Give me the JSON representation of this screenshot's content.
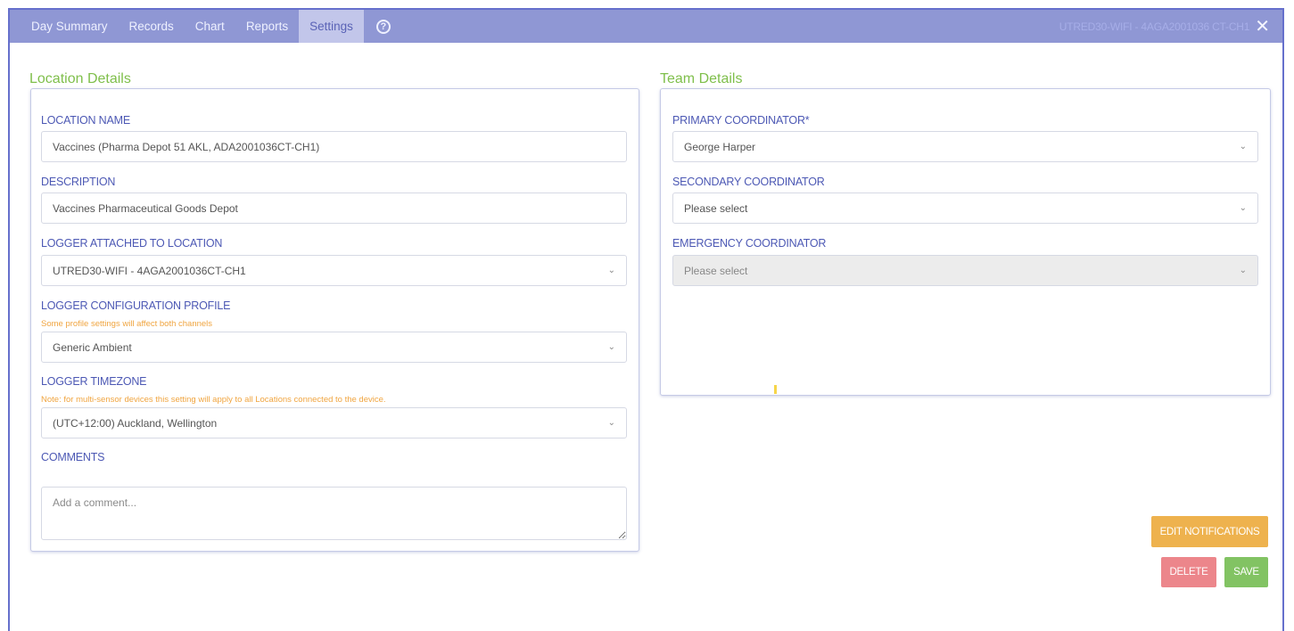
{
  "nav": {
    "tabs": [
      {
        "label": "Day Summary"
      },
      {
        "label": "Records"
      },
      {
        "label": "Chart"
      },
      {
        "label": "Reports"
      },
      {
        "label": "Settings"
      }
    ],
    "help_icon": "?",
    "device_id": "UTRED30-WIFI - 4AGA2001036 CT-CH1",
    "close_icon": "✕"
  },
  "location": {
    "title": "Location Details",
    "name_label": "LOCATION NAME",
    "name_value": "Vaccines (Pharma Depot 51 AKL, ADA2001036CT-CH1)",
    "description_label": "DESCRIPTION",
    "description_value": "Vaccines Pharmaceutical Goods Depot",
    "logger_label": "LOGGER ATTACHED TO LOCATION",
    "logger_value": "UTRED30-WIFI - 4AGA2001036CT-CH1",
    "profile_label": "LOGGER CONFIGURATION PROFILE",
    "profile_hint": "Some profile settings will affect both channels",
    "profile_value": "Generic Ambient",
    "timezone_label": "LOGGER TIMEZONE",
    "timezone_hint": "Note: for multi-sensor devices this setting will apply to all Locations connected to the device.",
    "timezone_value": "(UTC+12:00) Auckland, Wellington",
    "comments_label": "COMMENTS",
    "comments_placeholder": "Add a comment..."
  },
  "team": {
    "title": "Team Details",
    "primary_label": "PRIMARY COORDINATOR*",
    "primary_value": "George Harper",
    "secondary_label": "SECONDARY COORDINATOR",
    "secondary_value": "Please select",
    "emergency_label": "EMERGENCY COORDINATOR",
    "emergency_value": "Please select"
  },
  "actions": {
    "edit_notifications": "EDIT NOTIFICATIONS",
    "delete": "DELETE",
    "save": "SAVE"
  },
  "colors": {
    "nav_bg": "#8f97d4",
    "label": "#4c58b4",
    "section_title": "#7fbf4b",
    "edit": "#eeb24e",
    "delete": "#ec868b",
    "save": "#82c363"
  },
  "icons": {
    "select_chevron": "chevron-down-icon",
    "help": "question-circle-icon",
    "close": "close-icon"
  }
}
